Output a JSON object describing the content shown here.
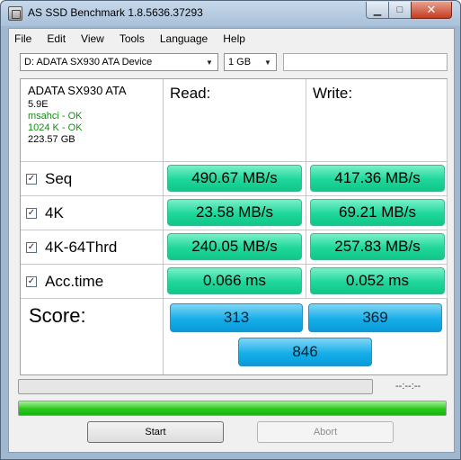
{
  "window": {
    "title": "AS SSD Benchmark 1.8.5636.37293"
  },
  "menu": [
    "File",
    "Edit",
    "View",
    "Tools",
    "Language",
    "Help"
  ],
  "toolbar": {
    "device_select": "D: ADATA SX930 ATA Device",
    "size_select": "1 GB",
    "extra_field": ""
  },
  "drive_info": {
    "name": "ADATA SX930 ATA",
    "firmware": "5.9E",
    "driver_status": "msahci - OK",
    "alignment_status": "1024 K - OK",
    "capacity": "223.57 GB"
  },
  "columns": {
    "read": "Read:",
    "write": "Write:"
  },
  "tests": [
    {
      "label": "Seq",
      "checked": true,
      "read": "490.67 MB/s",
      "write": "417.36 MB/s"
    },
    {
      "label": "4K",
      "checked": true,
      "read": "23.58 MB/s",
      "write": "69.21 MB/s"
    },
    {
      "label": "4K-64Thrd",
      "checked": true,
      "read": "240.05 MB/s",
      "write": "257.83 MB/s"
    },
    {
      "label": "Acc.time",
      "checked": true,
      "read": "0.066 ms",
      "write": "0.052 ms"
    }
  ],
  "score": {
    "label": "Score:",
    "read": "313",
    "write": "369",
    "total": "846"
  },
  "progress": {
    "test_progress": 0,
    "overall_progress": 100,
    "timer": "--:--:--"
  },
  "buttons": {
    "start": "Start",
    "abort": "Abort"
  },
  "colors": {
    "result_box": "#1ed79a",
    "score_box": "#16aee9",
    "progress_fill": "#29c81e"
  }
}
